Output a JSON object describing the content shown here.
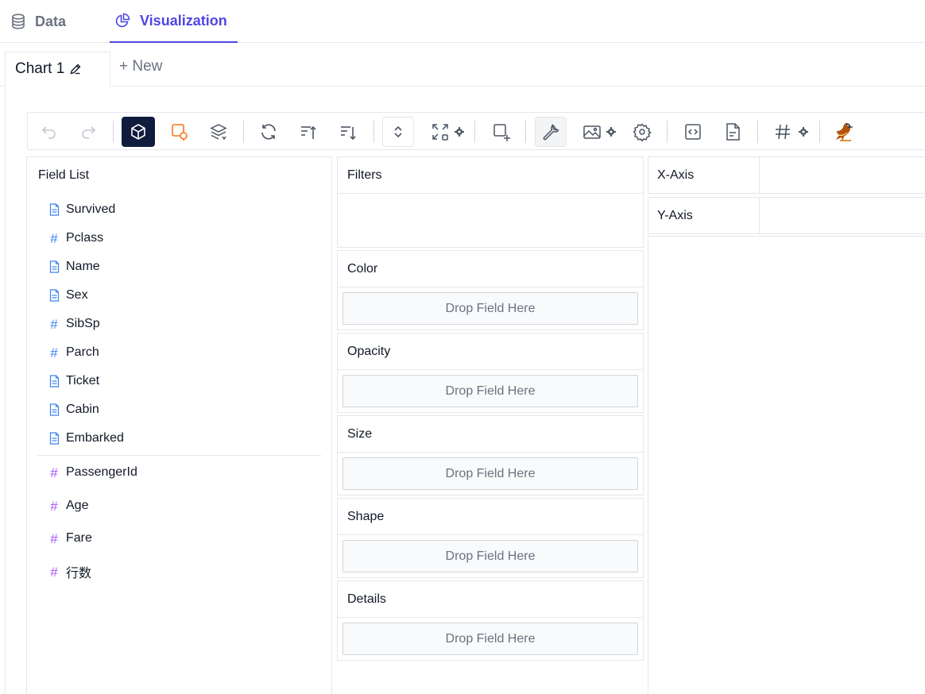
{
  "tabs": {
    "data_label": "Data",
    "viz_label": "Visualization"
  },
  "chart_tabs": {
    "chart1_label": "Chart 1",
    "new_label": "+ New"
  },
  "toolbar": {
    "buttons": [
      "undo-icon",
      "redo-icon",
      "cube-icon",
      "shape-icon",
      "layers-icon",
      "refresh-icon",
      "sort-asc-icon",
      "sort-desc-icon",
      "expand-collapse-icon",
      "fullscreen-icon",
      "settings-small-icon",
      "brush-icon",
      "wrench-icon",
      "image-icon",
      "settings-icon",
      "code-icon",
      "file-icon",
      "hash-icon",
      "bird-logo-icon"
    ]
  },
  "field_list": {
    "title": "Field List",
    "dimensions": [
      {
        "name": "Survived",
        "type": "doc"
      },
      {
        "name": "Pclass",
        "type": "hash"
      },
      {
        "name": "Name",
        "type": "doc"
      },
      {
        "name": "Sex",
        "type": "doc"
      },
      {
        "name": "SibSp",
        "type": "hash"
      },
      {
        "name": "Parch",
        "type": "hash"
      },
      {
        "name": "Ticket",
        "type": "doc"
      },
      {
        "name": "Cabin",
        "type": "doc"
      },
      {
        "name": "Embarked",
        "type": "doc"
      }
    ],
    "measures": [
      {
        "name": "PassengerId"
      },
      {
        "name": "Age"
      },
      {
        "name": "Fare"
      },
      {
        "name": "行数"
      }
    ]
  },
  "encodings": {
    "filters": "Filters",
    "color": "Color",
    "opacity": "Opacity",
    "size": "Size",
    "shape": "Shape",
    "details": "Details",
    "drop_placeholder": "Drop Field Here"
  },
  "axes": {
    "x_label": "X-Axis",
    "y_label": "Y-Axis"
  },
  "colors": {
    "accent": "#4f46e5",
    "active_button": "#111b3e",
    "dimension_icon": "#3b82f6",
    "measure_icon": "#a855f7",
    "shape_orange": "#f97316"
  }
}
